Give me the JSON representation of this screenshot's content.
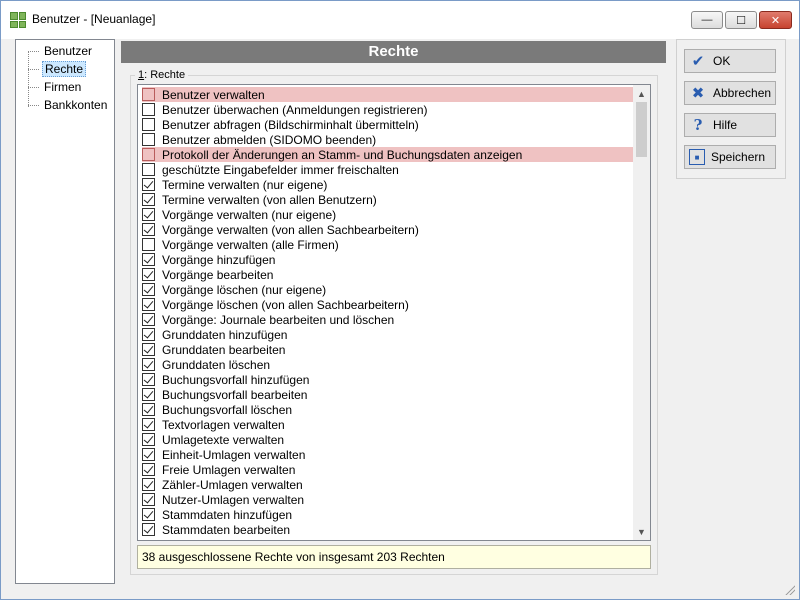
{
  "window": {
    "title": "Benutzer - [Neuanlage]",
    "controls": {
      "minimize": "—",
      "maximize": "☐",
      "close": "✕"
    }
  },
  "tree": {
    "items": [
      {
        "label": "Benutzer",
        "selected": false
      },
      {
        "label": "Rechte",
        "selected": true
      },
      {
        "label": "Firmen",
        "selected": false
      },
      {
        "label": "Bankkonten",
        "selected": false
      }
    ]
  },
  "panel": {
    "header": "Rechte",
    "group_label_accel": "1",
    "group_label_rest": ": Rechte"
  },
  "rights": [
    {
      "label": "Benutzer verwalten",
      "checked": false,
      "highlight": true
    },
    {
      "label": "Benutzer überwachen (Anmeldungen registrieren)",
      "checked": false,
      "highlight": false
    },
    {
      "label": "Benutzer abfragen (Bildschirminhalt übermitteln)",
      "checked": false,
      "highlight": false
    },
    {
      "label": "Benutzer abmelden (SIDOMO beenden)",
      "checked": false,
      "highlight": false
    },
    {
      "label": "Protokoll der Änderungen an Stamm- und Buchungsdaten anzeigen",
      "checked": false,
      "highlight": true
    },
    {
      "label": "geschützte Eingabefelder immer freischalten",
      "checked": false,
      "highlight": false
    },
    {
      "label": "Termine verwalten (nur eigene)",
      "checked": true,
      "highlight": false
    },
    {
      "label": "Termine verwalten (von allen Benutzern)",
      "checked": true,
      "highlight": false
    },
    {
      "label": "Vorgänge verwalten (nur eigene)",
      "checked": true,
      "highlight": false
    },
    {
      "label": "Vorgänge verwalten (von allen Sachbearbeitern)",
      "checked": true,
      "highlight": false
    },
    {
      "label": "Vorgänge verwalten (alle Firmen)",
      "checked": false,
      "highlight": false
    },
    {
      "label": "Vorgänge hinzufügen",
      "checked": true,
      "highlight": false
    },
    {
      "label": "Vorgänge bearbeiten",
      "checked": true,
      "highlight": false
    },
    {
      "label": "Vorgänge löschen (nur eigene)",
      "checked": true,
      "highlight": false
    },
    {
      "label": "Vorgänge löschen (von allen Sachbearbeitern)",
      "checked": true,
      "highlight": false
    },
    {
      "label": "Vorgänge: Journale bearbeiten und löschen",
      "checked": true,
      "highlight": false
    },
    {
      "label": "Grunddaten hinzufügen",
      "checked": true,
      "highlight": false
    },
    {
      "label": "Grunddaten bearbeiten",
      "checked": true,
      "highlight": false
    },
    {
      "label": "Grunddaten löschen",
      "checked": true,
      "highlight": false
    },
    {
      "label": "Buchungsvorfall hinzufügen",
      "checked": true,
      "highlight": false
    },
    {
      "label": "Buchungsvorfall bearbeiten",
      "checked": true,
      "highlight": false
    },
    {
      "label": "Buchungsvorfall löschen",
      "checked": true,
      "highlight": false
    },
    {
      "label": "Textvorlagen verwalten",
      "checked": true,
      "highlight": false
    },
    {
      "label": "Umlagetexte verwalten",
      "checked": true,
      "highlight": false
    },
    {
      "label": "Einheit-Umlagen verwalten",
      "checked": true,
      "highlight": false
    },
    {
      "label": "Freie Umlagen verwalten",
      "checked": true,
      "highlight": false
    },
    {
      "label": "Zähler-Umlagen verwalten",
      "checked": true,
      "highlight": false
    },
    {
      "label": "Nutzer-Umlagen verwalten",
      "checked": true,
      "highlight": false
    },
    {
      "label": "Stammdaten hinzufügen",
      "checked": true,
      "highlight": false
    },
    {
      "label": "Stammdaten bearbeiten",
      "checked": true,
      "highlight": false
    }
  ],
  "status_text": "38 ausgeschlossene Rechte von insgesamt 203 Rechten",
  "buttons": {
    "ok": {
      "label": "OK",
      "icon": "check-icon"
    },
    "cancel": {
      "label": "Abbrechen",
      "icon": "x-icon"
    },
    "help": {
      "label": "Hilfe",
      "icon": "help-icon"
    },
    "save": {
      "label": "Speichern",
      "icon": "floppy-icon"
    }
  },
  "colors": {
    "highlight": "#efc2c2",
    "header_bg": "#7a7a7a",
    "status_bg": "#ffffe1",
    "tree_selected": "#cce8ff"
  }
}
